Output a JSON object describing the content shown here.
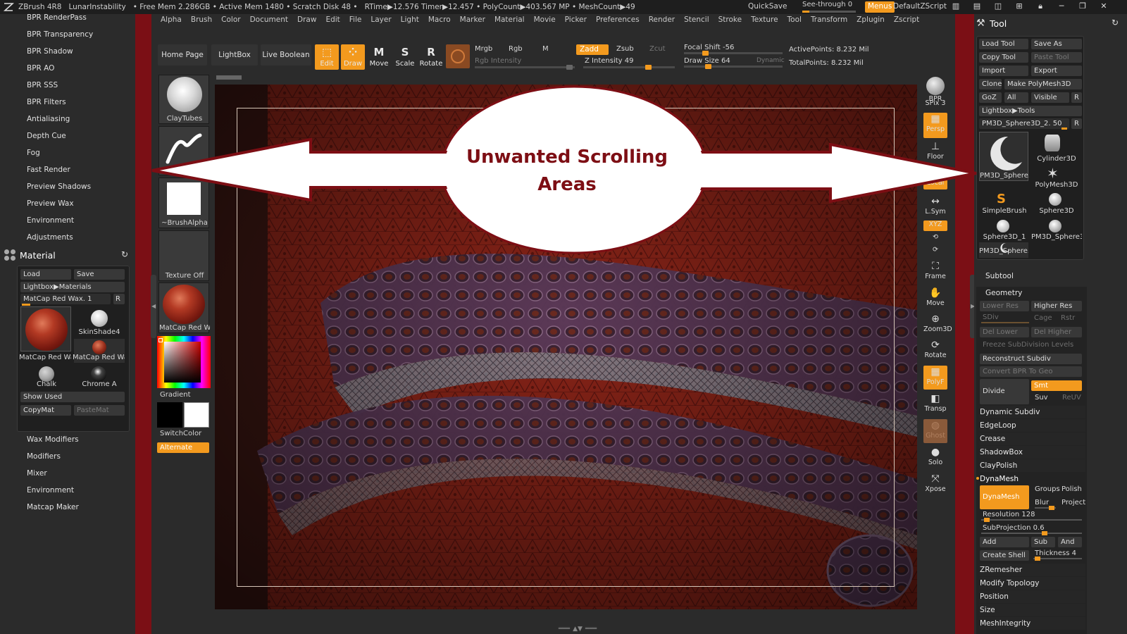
{
  "titlebar": {
    "app": "ZBrush 4R8",
    "project": "LunarInstability",
    "stats": "• Free Mem 2.286GB • Active Mem 1480 • Scratch Disk 48 •",
    "rtime": "RTime▶12.576 Timer▶12.457 • PolyCount▶403.567 MP • MeshCount▶49",
    "quicksave": "QuickSave",
    "seethrough": "See-through  0",
    "seethrough_level": 0,
    "menus": "Menus",
    "defaultzscript": "DefaultZScript"
  },
  "left_palette": {
    "render_items": [
      "BPR RenderPass",
      "BPR Transparency",
      "BPR Shadow",
      "BPR AO",
      "BPR SSS",
      "BPR Filters",
      "Antialiasing",
      "Depth Cue",
      "Fog",
      "Fast Render",
      "Preview Shadows",
      "Preview Wax",
      "Environment",
      "Adjustments"
    ],
    "material": {
      "title": "Material",
      "load": "Load",
      "save": "Save",
      "lightbox": "Lightbox▶Materials",
      "current_slider": "MatCap Red Wax. 1",
      "r_button": "R",
      "thumbs": [
        "MatCap Red Wa",
        "SkinShade4",
        "MatCap Red Wa",
        "Chalk",
        "Chrome A"
      ],
      "show_used": "Show Used",
      "copymat": "CopyMat",
      "pastemat": "PasteMat"
    },
    "lower_items": [
      "Wax Modifiers",
      "Modifiers",
      "Mixer",
      "Environment",
      "Matcap Maker"
    ]
  },
  "menu_row": [
    "Alpha",
    "Brush",
    "Color",
    "Document",
    "Draw",
    "Edit",
    "File",
    "Layer",
    "Light",
    "Macro",
    "Marker",
    "Material",
    "Movie",
    "Picker",
    "Preferences",
    "Render",
    "Stencil",
    "Stroke",
    "Texture",
    "Tool",
    "Transform",
    "Zplugin",
    "Zscript"
  ],
  "toolbar": {
    "home_page": "Home Page",
    "lightbox": "LightBox",
    "live_boolean": "Live Boolean",
    "edit": "Edit",
    "draw": "Draw",
    "move": "Move",
    "scale": "Scale",
    "rotate": "Rotate",
    "mrgb": "Mrgb",
    "rgb": "Rgb",
    "m": "M",
    "rgb_intensity": "Rgb Intensity",
    "zadd": "Zadd",
    "zsub": "Zsub",
    "zcut": "Zcut",
    "z_intensity": "Z Intensity 49",
    "z_intensity_value": 49,
    "focal_shift": "Focal Shift -56",
    "draw_size": "Draw Size 64",
    "dynamic": "Dynamic",
    "active_points": "ActivePoints: 8.232 Mil",
    "total_points": "TotalPoints: 8.232 Mil"
  },
  "shelf": {
    "brush": "ClayTubes",
    "stroke": "",
    "alpha": "~BrushAlpha",
    "texture": "Texture Off",
    "material": "MatCap Red Wa",
    "gradient": "Gradient",
    "switchcolor": "SwitchColor",
    "alternate": "Alternate"
  },
  "right_shelf": [
    {
      "glyph": "●",
      "label": "BPR"
    },
    {
      "glyph": "",
      "label": "SPix 3"
    },
    {
      "glyph": "▦",
      "label": "Persp"
    },
    {
      "glyph": "⊥",
      "label": "Floor"
    },
    {
      "glyph": "",
      "label": "Local"
    },
    {
      "glyph": "↔",
      "label": "L.Sym"
    },
    {
      "glyph": "",
      "label": "XYZ"
    },
    {
      "glyph": "⟲",
      "label": ""
    },
    {
      "glyph": "⟳",
      "label": ""
    },
    {
      "glyph": "⛶",
      "label": "Frame"
    },
    {
      "glyph": "✋",
      "label": "Move"
    },
    {
      "glyph": "⊕",
      "label": "Zoom3D"
    },
    {
      "glyph": "⟳",
      "label": "Rotate"
    },
    {
      "glyph": "▦",
      "label": "PolyF"
    },
    {
      "glyph": "◧",
      "label": "Transp"
    },
    {
      "glyph": "◍",
      "label": "Ghost"
    },
    {
      "glyph": "●",
      "label": "Solo"
    },
    {
      "glyph": "⤧",
      "label": "Xpose"
    }
  ],
  "tool_panel": {
    "title": "Tool",
    "load_tool": "Load Tool",
    "save_as": "Save As",
    "copy_tool": "Copy Tool",
    "paste_tool": "Paste Tool",
    "import": "Import",
    "export": "Export",
    "clone": "Clone",
    "make_polymesh": "Make PolyMesh3D",
    "goz": "GoZ",
    "all": "All",
    "visible": "Visible",
    "r": "R",
    "lightbox_tools": "Lightbox▶Tools",
    "current_tool": "PM3D_Sphere3D_2. 50",
    "tools": [
      "PM3D_Sphere3",
      "Cylinder3D",
      "PolyMesh3D",
      "SimpleBrush",
      "Sphere3D",
      "Sphere3D_1",
      "PM3D_Sphere3I",
      "PM3D_Sphere3"
    ],
    "subtool": "Subtool",
    "geometry": "Geometry",
    "lower_res": "Lower Res",
    "higher_res": "Higher Res",
    "sdiv": "SDiv",
    "cage": "Cage",
    "rstr": "Rstr",
    "del_lower": "Del Lower",
    "del_higher": "Del Higher",
    "freeze": "Freeze SubDivision Levels",
    "reconstruct": "Reconstruct Subdiv",
    "convert_bpr": "Convert BPR To Geo",
    "divide": "Divide",
    "smt": "Smt",
    "suv": "Suv",
    "reuv": "ReUV",
    "sections": [
      "Dynamic Subdiv",
      "EdgeLoop",
      "Crease",
      "ShadowBox",
      "ClayPolish"
    ],
    "dynamesh_header": "DynaMesh",
    "dynamesh_btn": "DynaMesh",
    "groups": "Groups",
    "polish": "Polish",
    "blur": "Blur",
    "project": "Project",
    "resolution": "Resolution 128",
    "subprojection": "SubProjection 0.6",
    "add": "Add",
    "sub": "Sub",
    "and": "And",
    "create_shell": "Create Shell",
    "thickness": "Thickness 4",
    "lower_sections": [
      "ZRemesher",
      "Modify Topology",
      "Position",
      "Size",
      "MeshIntegrity"
    ]
  },
  "annotation": {
    "text_line1": "Unwanted Scrolling",
    "text_line2": "Areas"
  },
  "colors": {
    "accent": "#f39a1e",
    "annotation_red": "#7d0e14",
    "panel_bg": "#2b2b2b"
  }
}
